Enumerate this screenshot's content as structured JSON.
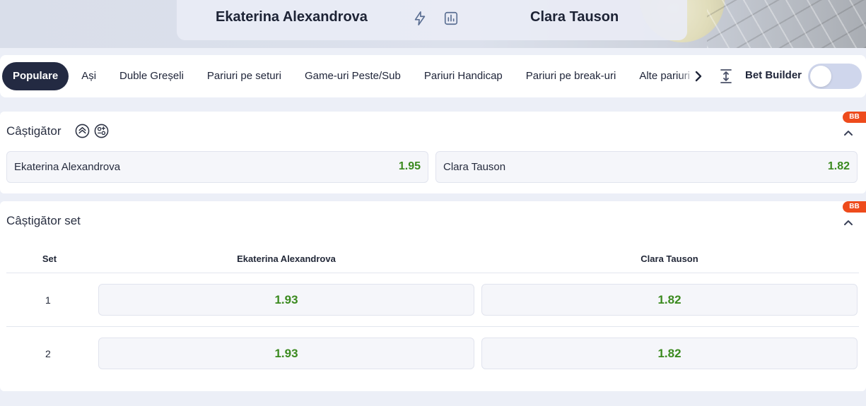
{
  "header": {
    "team_home": "Ekaterina Alexandrova",
    "team_away": "Clara Tauson",
    "icons": [
      "lightning-icon",
      "stats-icon"
    ]
  },
  "tabs": [
    {
      "label": "Populare",
      "active": true
    },
    {
      "label": "Ași",
      "active": false
    },
    {
      "label": "Duble Greșeli",
      "active": false
    },
    {
      "label": "Pariuri pe seturi",
      "active": false
    },
    {
      "label": "Game-uri Peste/Sub",
      "active": false
    },
    {
      "label": "Pariuri Handicap",
      "active": false
    },
    {
      "label": "Pariuri pe break-uri",
      "active": false
    },
    {
      "label": "Alte pariuri",
      "active": false
    }
  ],
  "bet_builder": {
    "label": "Bet Builder",
    "enabled": false
  },
  "markets": {
    "winner": {
      "title": "Câștigător",
      "badge": "BB",
      "outcomes": [
        {
          "name": "Ekaterina Alexandrova",
          "price": "1.95"
        },
        {
          "name": "Clara Tauson",
          "price": "1.82"
        }
      ]
    },
    "set_winner": {
      "title": "Câștigător set",
      "badge": "BB",
      "headers": {
        "set": "Set",
        "home": "Ekaterina Alexandrova",
        "away": "Clara Tauson"
      },
      "rows": [
        {
          "set": "1",
          "home": "1.93",
          "away": "1.82"
        },
        {
          "set": "2",
          "home": "1.93",
          "away": "1.82"
        }
      ]
    }
  },
  "colors": {
    "odds": "#3b8a1f",
    "badge": "#ee4b1c",
    "active_tab": "#232a42"
  }
}
